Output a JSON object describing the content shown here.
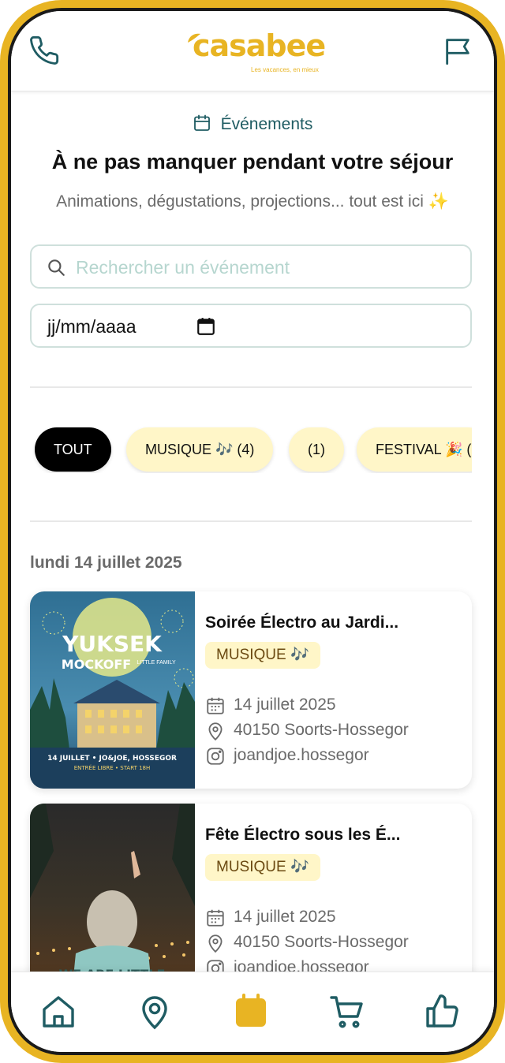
{
  "header": {
    "logo_text": "casabee",
    "logo_tagline": "Les vacances, en mieux"
  },
  "section": {
    "tag": "Événements",
    "title": "À ne pas manquer pendant votre séjour",
    "subtitle": "Animations, dégustations, projections... tout est ici ✨"
  },
  "search": {
    "placeholder": "Rechercher un événement"
  },
  "date_filter": {
    "value": "jj/mm/aaaa"
  },
  "filters": [
    {
      "label": "TOUT",
      "active": true
    },
    {
      "label": "MUSIQUE 🎶 (4)",
      "active": false
    },
    {
      "label": "(1)",
      "active": false
    },
    {
      "label": "FESTIVAL 🎉 (",
      "active": false
    }
  ],
  "date_heading": "lundi 14 juillet 2025",
  "events": [
    {
      "title": "Soirée Électro au Jardi...",
      "category": "MUSIQUE 🎶",
      "date": "14 juillet 2025",
      "location": "40150 Soorts-Hossegor",
      "instagram": "joandjoe.hossegor",
      "poster": {
        "headline": "YUKSEK",
        "subline": "MOCKOFF",
        "small": "LITTLE FAMILY",
        "footer": "14 JUILLET • JO&JOE, HOSSEGOR",
        "footer2": "ENTRÉE LIBRE • START 18H"
      }
    },
    {
      "title": "Fête Électro sous les É...",
      "category": "MUSIQUE 🎶",
      "date": "14 juillet 2025",
      "location": "40150 Soorts-Hossegor",
      "instagram": "joandjoe.hossegor",
      "poster": {
        "shirt": "WE ARE LITTLE"
      }
    }
  ],
  "colors": {
    "brand_yellow": "#E8B423",
    "teal": "#1F5C63",
    "chip_bg": "#FFF6C8"
  },
  "bottom_nav": [
    "home-icon",
    "map-pin-icon",
    "calendar-icon",
    "cart-icon",
    "thumbs-up-icon"
  ]
}
